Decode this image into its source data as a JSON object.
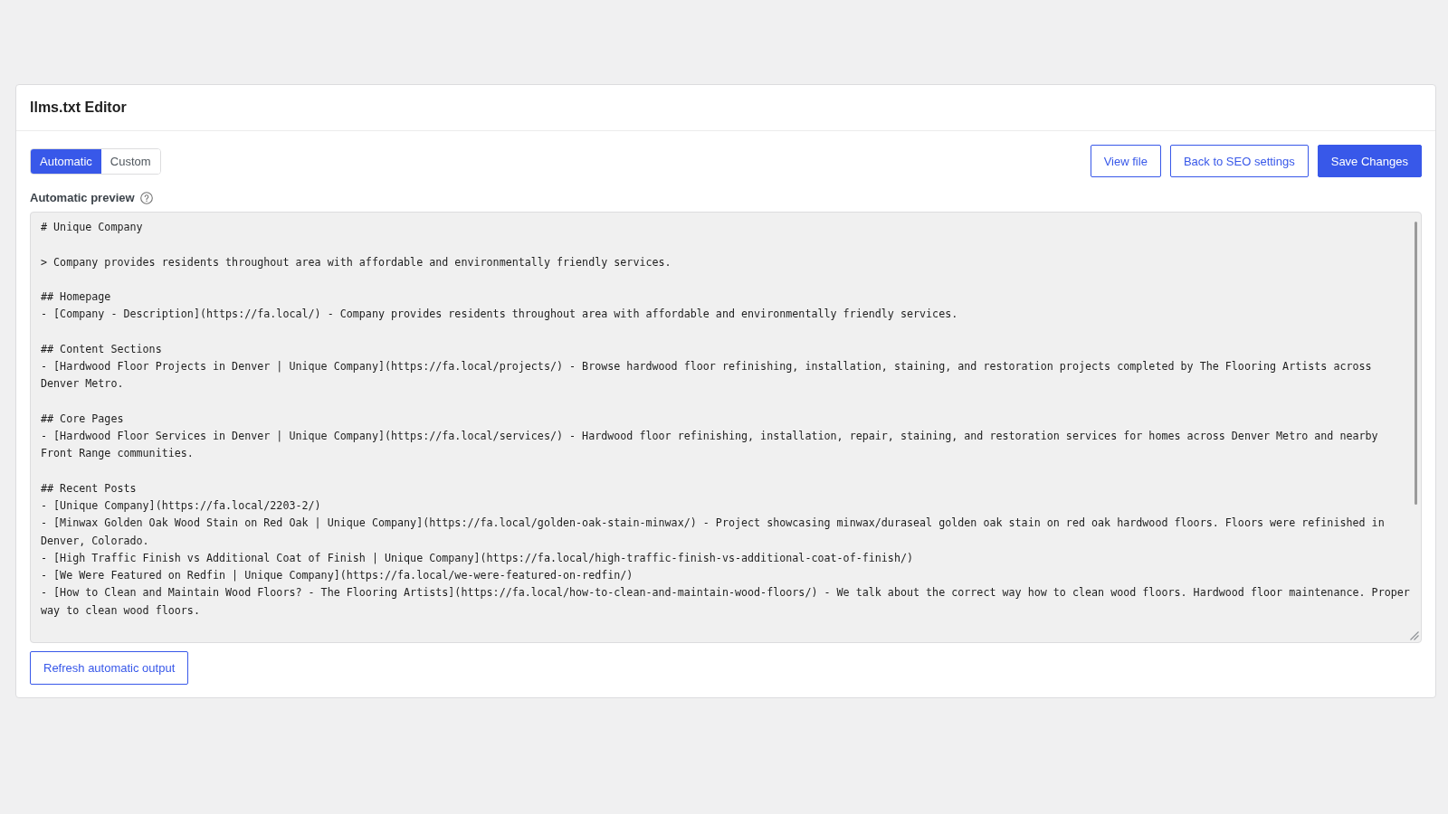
{
  "editor": {
    "title": "llms.txt Editor"
  },
  "mode_tabs": [
    {
      "label": "Automatic",
      "selected": true
    },
    {
      "label": "Custom",
      "selected": false
    }
  ],
  "actions": [
    {
      "label": "View file",
      "kind": "outline"
    },
    {
      "label": "Back to SEO settings",
      "kind": "outline"
    },
    {
      "label": "Save Changes",
      "kind": "primary"
    }
  ],
  "preview": {
    "label": "Automatic preview",
    "blocks": [
      [
        "# Unique Company"
      ],
      [
        "> Company provides residents throughout area with affordable and environmentally friendly services."
      ],
      [
        "## Homepage",
        "- [Company - Description](https://fa.local/) - Company provides residents throughout area with affordable and environmentally friendly services."
      ],
      [
        "## Content Sections",
        "- [Hardwood Floor Projects in Denver | Unique Company](https://fa.local/projects/) - Browse hardwood floor refinishing, installation, staining, and restoration projects completed by The Flooring Artists across Denver Metro."
      ],
      [
        "## Core Pages",
        "- [Hardwood Floor Services in Denver | Unique Company](https://fa.local/services/) - Hardwood floor refinishing, installation, repair, staining, and restoration services for homes across Denver Metro and nearby Front Range communities."
      ],
      [
        "## Recent Posts",
        "- [Unique Company](https://fa.local/2203-2/)",
        "- [Minwax Golden Oak Wood Stain on Red Oak | Unique Company](https://fa.local/golden-oak-stain-minwax/) - Project showcasing minwax/duraseal golden oak stain on red oak hardwood floors. Floors were refinished in Denver, Colorado.",
        "- [High Traffic Finish vs Additional Coat of Finish | Unique Company](https://fa.local/high-traffic-finish-vs-additional-coat-of-finish/)",
        "- [We Were Featured on Redfin | Unique Company](https://fa.local/we-were-featured-on-redfin/)",
        "- [How to Clean and Maintain Wood Floors? - The Flooring Artists](https://fa.local/how-to-clean-and-maintain-wood-floors/) - We talk about the correct way how to clean wood floors. Hardwood floor maintenance. Proper way to clean wood floors."
      ]
    ]
  },
  "refresh_button": {
    "label": "Refresh automatic output"
  }
}
